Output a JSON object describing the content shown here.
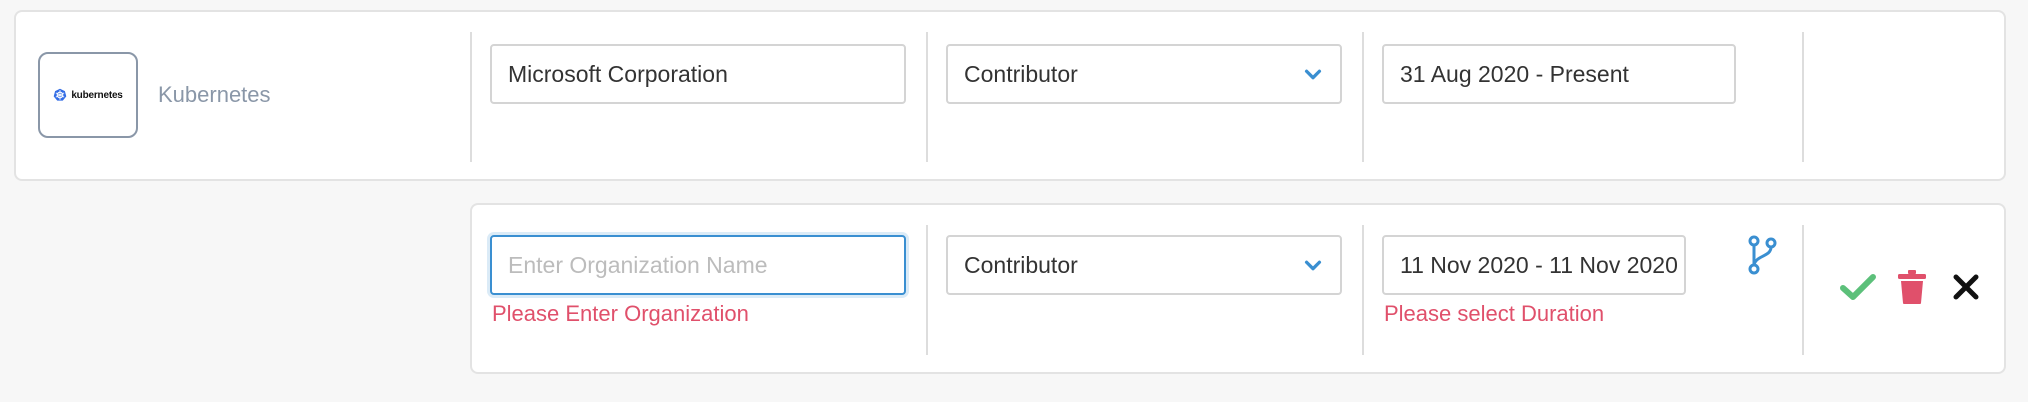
{
  "rows": [
    {
      "project": {
        "logo_text": "kubernetes",
        "name": "Kubernetes"
      },
      "organization": {
        "value": "Microsoft Corporation",
        "placeholder": ""
      },
      "role": {
        "selected": "Contributor"
      },
      "duration": {
        "value": "31 Aug 2020 - Present"
      }
    },
    {
      "organization": {
        "value": "",
        "placeholder": "Enter Organization Name",
        "error": "Please Enter Organization"
      },
      "role": {
        "selected": "Contributor"
      },
      "duration": {
        "value": "11 Nov 2020 - 11 Nov 2020",
        "error": "Please select Duration"
      }
    }
  ],
  "icons": {
    "chevron": "chevron-down-icon",
    "branch": "git-branch-icon",
    "confirm": "checkmark-icon",
    "delete": "trash-icon",
    "cancel": "close-icon"
  },
  "colors": {
    "accent_blue": "#3a8fd1",
    "error_red": "#e0506b",
    "confirm_green": "#5cc07a",
    "delete_red": "#e0506b",
    "muted_text": "#8a97a8"
  }
}
